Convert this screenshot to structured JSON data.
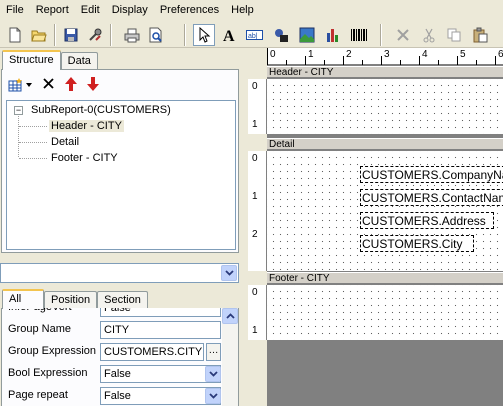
{
  "menu": [
    "File",
    "Report",
    "Edit",
    "Display",
    "Preferences",
    "Help"
  ],
  "left_tabs": {
    "structure": "Structure",
    "data": "Data"
  },
  "tree": {
    "root": "SubReport-0(CUSTOMERS)",
    "children": [
      "Header - CITY",
      "Detail",
      "Footer - CITY"
    ],
    "selected": "Header - CITY"
  },
  "prop_tabs": {
    "all": "All",
    "position": "Position",
    "section": "Section"
  },
  "properties": [
    {
      "name": "InfoPageVert",
      "value": "False"
    },
    {
      "name": "Group Name",
      "value": "CITY"
    },
    {
      "name": "Group Expression",
      "value": "CUSTOMERS.CITY"
    },
    {
      "name": "Bool Expression",
      "value": "False"
    },
    {
      "name": "Page repeat",
      "value": "False"
    }
  ],
  "ruler_marks": [
    "0",
    "1",
    "2",
    "3",
    "4",
    "5",
    "6"
  ],
  "bands": {
    "header": "Header - CITY",
    "detail": "Detail",
    "footer": "Footer - CITY"
  },
  "header_ruler": [
    "0",
    "1"
  ],
  "detail_ruler": [
    "0",
    "1",
    "2"
  ],
  "footer_ruler": [
    "0",
    "1"
  ],
  "detail_fields": [
    "CUSTOMERS.CompanyName",
    "CUSTOMERS.ContactName",
    "CUSTOMERS.Address",
    "CUSTOMERS.City"
  ],
  "colors": {
    "accent_tab": "#f3c44f",
    "border": "#7f9db9",
    "arrow_red": "#d02020"
  }
}
